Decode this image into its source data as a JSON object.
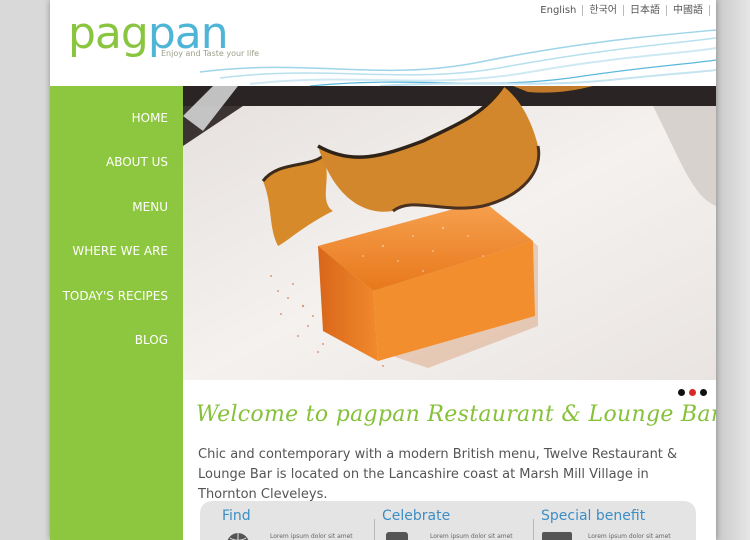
{
  "header": {
    "logo_part1": "pag",
    "logo_part2": "pan",
    "tagline": "Enjoy and Taste your life",
    "languages": [
      "English",
      "한국어",
      "日本語",
      "中國語"
    ]
  },
  "sidebar": {
    "items": [
      {
        "label": "HOME"
      },
      {
        "label": "ABOUT US"
      },
      {
        "label": "MENU"
      },
      {
        "label": "WHERE WE ARE"
      },
      {
        "label": "TODAY'S RECIPES"
      },
      {
        "label": "BLOG"
      }
    ]
  },
  "slider": {
    "dots": 3,
    "active_index": 1
  },
  "main": {
    "welcome_title": "Welcome to pagpan Restaurant & Lounge Bar",
    "intro": "Chic and contemporary with a modern British menu, Twelve Restaurant & Lounge Bar is located on the Lancashire coast at Marsh Mill Village in Thornton Cleveleys."
  },
  "info": {
    "columns": [
      {
        "title": "Find",
        "text": "Lorem ipsum dolor sit amet"
      },
      {
        "title": "Celebrate",
        "text": "Lorem ipsum dolor sit amet"
      },
      {
        "title": "Special benefit",
        "text": "Lorem ipsum dolor sit amet"
      }
    ]
  },
  "colors": {
    "brand_green": "#8dc63f",
    "brand_blue": "#4fb5d6",
    "link_blue": "#3c8ec5",
    "slider_active": "#d8282a"
  }
}
